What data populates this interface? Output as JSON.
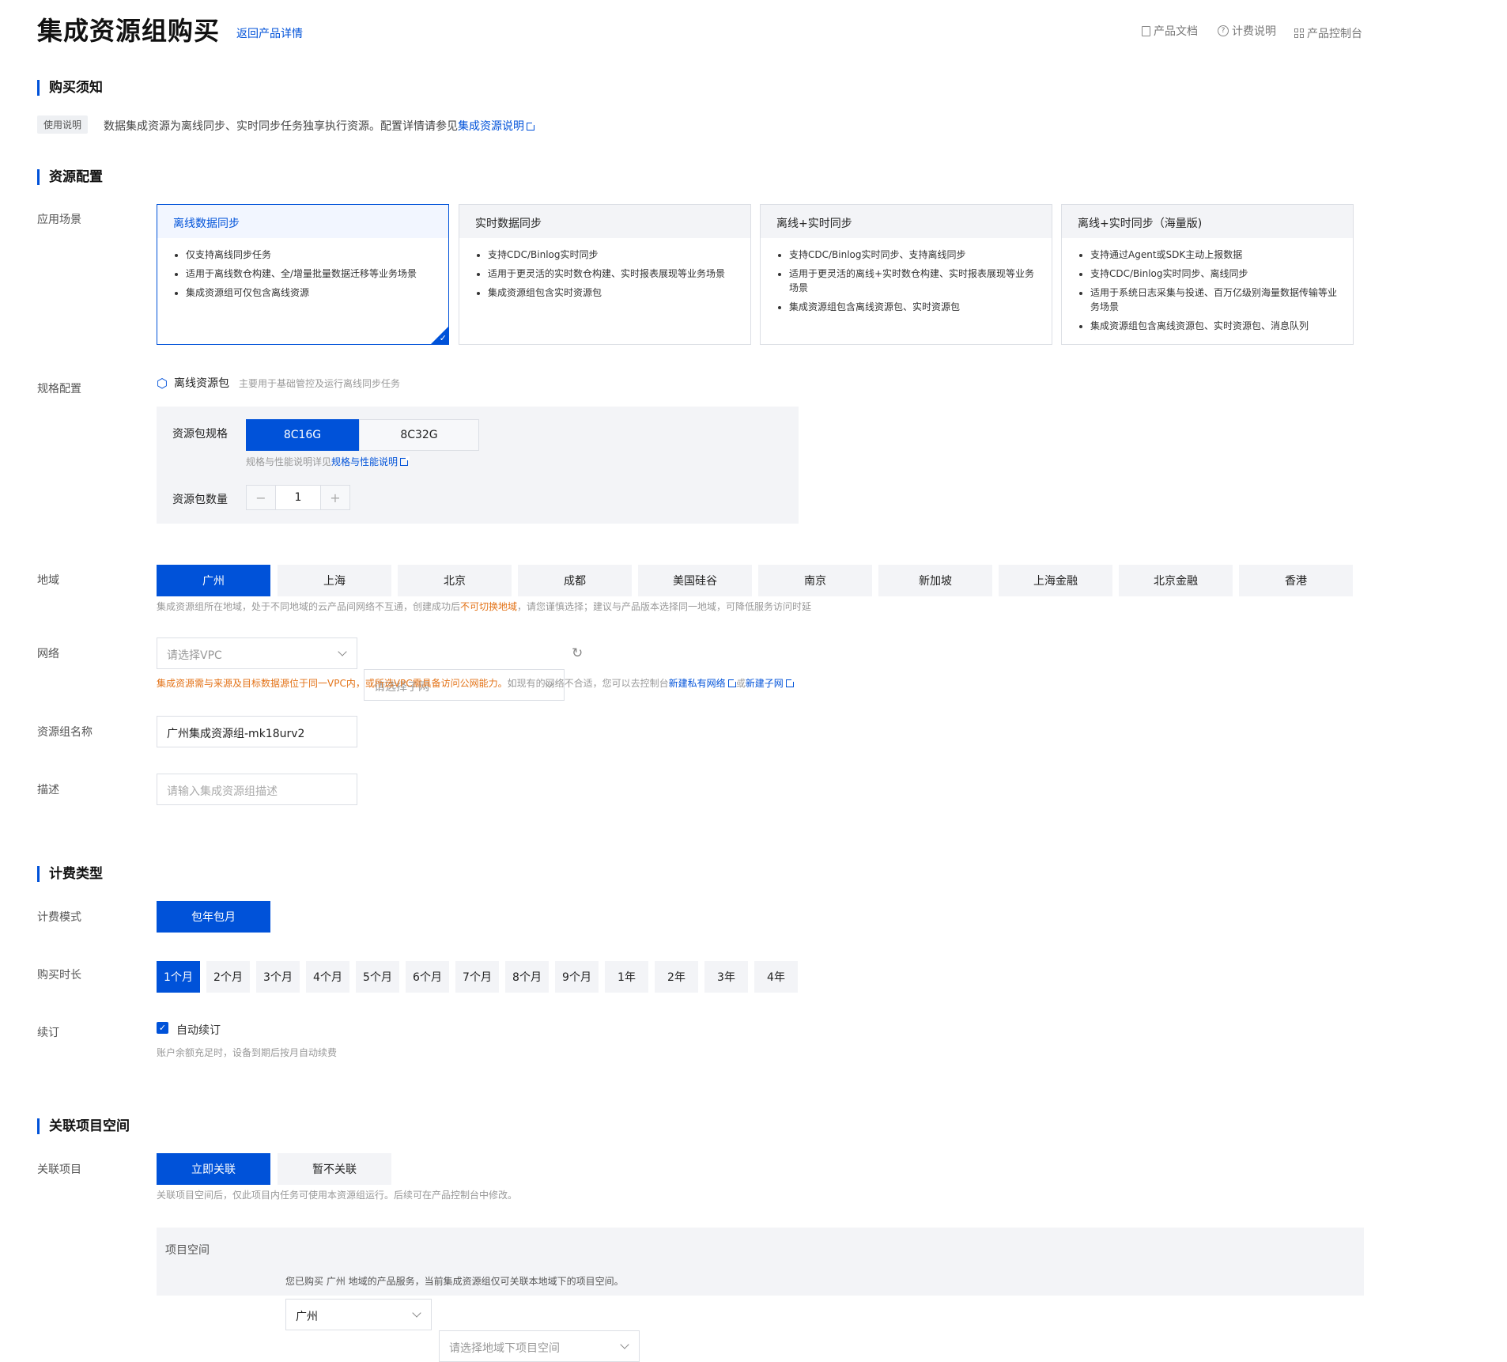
{
  "header": {
    "title": "集成资源组购买",
    "back_link": "返回产品详情",
    "links": [
      "产品文档",
      "计费说明",
      "产品控制台"
    ]
  },
  "notice": {
    "section_title": "购买须知",
    "tag": "使用说明",
    "text": "数据集成资源为离线同步、实时同步任务独享执行资源。配置详情请参见",
    "link": "集成资源说明"
  },
  "resource": {
    "section_title": "资源配置",
    "scenario_label": "应用场景",
    "cards": [
      {
        "title": "离线数据同步",
        "items": [
          "仅支持离线同步任务",
          "适用于离线数仓构建、全/增量批量数据迁移等业务场景",
          "集成资源组可仅包含离线资源"
        ]
      },
      {
        "title": "实时数据同步",
        "items": [
          "支持CDC/Binlog实时同步",
          "适用于更灵活的实时数仓构建、实时报表展现等业务场景",
          "集成资源组包含实时资源包"
        ]
      },
      {
        "title": "离线+实时同步",
        "items": [
          "支持CDC/Binlog实时同步、支持离线同步",
          "适用于更灵活的离线+实时数仓构建、实时报表展现等业务场景",
          "集成资源组包含离线资源包、实时资源包"
        ]
      },
      {
        "title": "离线+实时同步（海量版)",
        "items": [
          "支持通过Agent或SDK主动上报数据",
          "支持CDC/Binlog实时同步、离线同步",
          "适用于系统日志采集与投递、百万亿级别海量数据传输等业务场景",
          "集成资源组包含离线资源包、实时资源包、消息队列"
        ]
      }
    ],
    "spec_label": "规格配置",
    "pkg_name": "离线资源包",
    "pkg_desc": "主要用于基础管控及运行离线同步任务",
    "spec_field": "资源包规格",
    "specs": [
      "8C16G",
      "8C32G"
    ],
    "spec_hint": "规格与性能说明详见",
    "spec_hint_link": "规格与性能说明",
    "qty_field": "资源包数量",
    "qty": "1",
    "minus": "−",
    "plus": "+",
    "region_label": "地域",
    "regions": [
      "广州",
      "上海",
      "北京",
      "成都",
      "美国硅谷",
      "南京",
      "新加坡",
      "上海金融",
      "北京金融",
      "香港"
    ],
    "region_hint_a": "集成资源组所在地域，处于不同地域的云产品间网络不互通，创建成功后",
    "region_hint_warn": "不可切换地域",
    "region_hint_b": "，请您谨慎选择；建议与产品版本选择同一地域，可降低服务访问时延",
    "network_label": "网络",
    "vpc_placeholder": "请选择VPC",
    "subnet_placeholder": "请选择子网",
    "network_warn": "集成资源需与来源及目标数据源位于同一VPC内，或所选VPC需具备访问公网能力。",
    "network_hint": "如现有的网络不合适，您可以去控制台",
    "new_vpc": "新建私有网络",
    "or": "或",
    "new_subnet": "新建子网",
    "name_label": "资源组名称",
    "name_value": "广州集成资源组-mk18urv2",
    "desc_label": "描述",
    "desc_placeholder": "请输入集成资源组描述"
  },
  "billing": {
    "section_title": "计费类型",
    "mode_label": "计费模式",
    "mode": "包年包月",
    "duration_label": "购买时长",
    "durations": [
      "1个月",
      "2个月",
      "3个月",
      "4个月",
      "5个月",
      "6个月",
      "7个月",
      "8个月",
      "9个月",
      "1年",
      "2年",
      "3年",
      "4年"
    ],
    "renew_label": "续订",
    "auto_renew": "自动续订",
    "renew_hint": "账户余额充足时，设备到期后按月自动续费"
  },
  "project": {
    "section_title": "关联项目空间",
    "label": "关联项目",
    "options": [
      "立即关联",
      "暂不关联"
    ],
    "hint": "关联项目空间后，仅此项目内任务可使用本资源组运行。后续可在产品控制台中修改。",
    "space_label": "项目空间",
    "region_value": "广州",
    "space_placeholder": "请选择地域下项目空间",
    "space_hint": "您已购买 广州 地域的产品服务，当前集成资源组仅可关联本地域下的项目空间。"
  }
}
